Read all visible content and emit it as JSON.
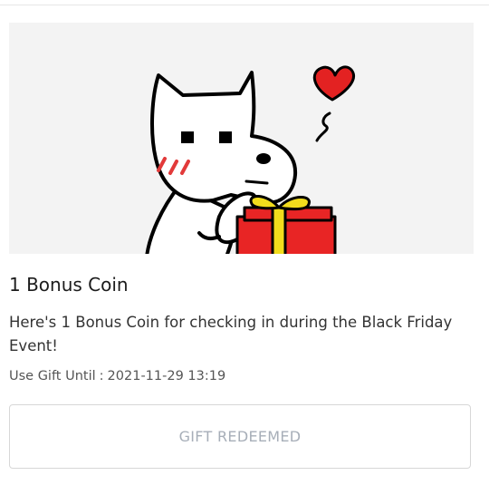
{
  "gift": {
    "title": "1 Bonus Coin",
    "description": "Here's 1 Bonus Coin for checking in during the Black Friday Event!",
    "expiry_label": "Use Gift Until",
    "expiry_separator": ":",
    "expiry_value": "2021-11-29 13:19",
    "button_label": "GIFT REDEEMED",
    "button_state": "disabled"
  },
  "banner": {
    "illustration": "cat-holding-gift-illustration",
    "icons": [
      "heart-icon",
      "gift-box-icon"
    ],
    "colors": {
      "background": "#f3f3f3",
      "heart": "#e32222",
      "gift_box": "#e82525",
      "gift_ribbon": "#f2dc1c",
      "blush": "#e23a3a"
    }
  },
  "colors": {
    "button_text_disabled": "#a7aeb8",
    "button_border": "#d7d7d7"
  }
}
